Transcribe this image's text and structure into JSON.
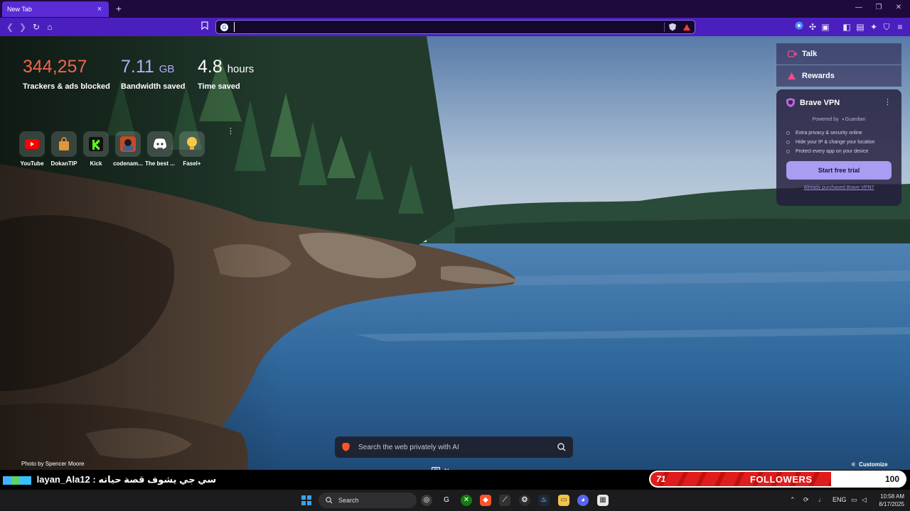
{
  "browser": {
    "tab_title": "New Tab",
    "tab_close": "×",
    "new_tab": "+",
    "window_controls": {
      "minimize": "—",
      "maximize": "❐",
      "close": "✕"
    },
    "address_placeholder": "",
    "search_engine_icon": "G"
  },
  "stats": [
    {
      "value": "344,257",
      "unit": "",
      "label": "Trackers & ads blocked",
      "color": "#f3654f"
    },
    {
      "value": "7.11",
      "unit": "GB",
      "label": "Bandwidth saved",
      "color": "#b6acf8"
    },
    {
      "value": "4.8",
      "unit": "hours",
      "label": "Time saved",
      "color": "#ffffff"
    }
  ],
  "shortcuts": [
    {
      "label": "YouTube",
      "icon": "youtube-icon"
    },
    {
      "label": "DokanTIP",
      "icon": "bag-icon"
    },
    {
      "label": "Kick",
      "icon": "kick-icon"
    },
    {
      "label": "codenam...",
      "icon": "game-art-icon"
    },
    {
      "label": "The best ...",
      "icon": "discord-icon"
    },
    {
      "label": "Fasel+",
      "icon": "bulb-icon"
    }
  ],
  "panel": {
    "talk": "Talk",
    "rewards": "Rewards",
    "vpn": {
      "title": "Brave VPN",
      "menu": "⋮",
      "powered_by": "Powered by",
      "provider": "Guardian",
      "features": [
        "Extra privacy & security online",
        "Hide your IP & change your location",
        "Protect every app on your device"
      ],
      "cta": "Start free trial",
      "link": "Already purchased Brave VPN?"
    }
  },
  "photo_credit": "Photo by Spencer Moore",
  "search": {
    "placeholder": "Search the web privately with AI"
  },
  "news_label": "News",
  "customize_label": "Customize",
  "stream_overlay": {
    "chat_user": "layan_Ala12",
    "chat_message": "سي جي يشوف قصة حياته",
    "followers_count": "71",
    "followers_label": "FOLLOWERS",
    "followers_goal": "100",
    "followers_progress": 0.71
  },
  "taskbar": {
    "search_label": "Search",
    "language": "ENG",
    "time": "10:58 AM",
    "date": "8/17/2025"
  },
  "colors": {
    "brave_orange": "#fb542b",
    "toolbar_purple": "#4a1fbe",
    "followers_red": "#e01c1c"
  }
}
